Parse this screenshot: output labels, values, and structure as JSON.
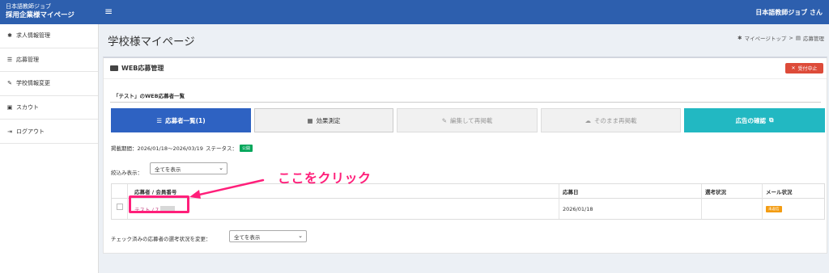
{
  "header": {
    "brand_line1": "日本語教師ジョブ",
    "brand_line2": "採用企業様マイページ",
    "menu_icon": "≡",
    "user_label": "日本語教師ジョブ さん",
    "bar_color": "#2d5fae"
  },
  "sidebar": {
    "items": [
      {
        "icon": "briefcase-icon",
        "glyph": "✱",
        "label": "求人情報管理"
      },
      {
        "icon": "list-icon",
        "glyph": "☰",
        "label": "応募管理"
      },
      {
        "icon": "edit-icon",
        "glyph": "✎",
        "label": "学校情報変更"
      },
      {
        "icon": "user-icon",
        "glyph": "▣",
        "label": "スカウト"
      },
      {
        "icon": "logout-icon",
        "glyph": "⇥",
        "label": "ログアウト"
      }
    ]
  },
  "page": {
    "title": "学校様マイページ",
    "breadcrumb": {
      "home_glyph": "✱",
      "home": "マイページトップ",
      "sep": ">",
      "current_glyph": "▤",
      "current": "応募管理"
    }
  },
  "card": {
    "title": "WEB応募管理",
    "stop_button": "受付中止",
    "stop_glyph": "✕",
    "list_title": "「テスト」のWEB応募者一覧",
    "tabs": [
      {
        "glyph": "☰",
        "label": "応募者一覧(1)",
        "state": "active"
      },
      {
        "glyph": "▦",
        "label": "効果測定",
        "state": "default"
      },
      {
        "glyph": "✎",
        "label": "編集して再掲載",
        "state": "disabled"
      },
      {
        "glyph": "☁",
        "label": "そのまま再掲載",
        "state": "disabled"
      },
      {
        "glyph": "⧉",
        "label": "広告の確認",
        "state": "info"
      }
    ],
    "period_label": "掲載期間：2026/01/18〜2026/03/19",
    "status_label": "ステータス：",
    "status_badge": "公開",
    "filter_label": "絞込み表示：",
    "filter_value": "全てを表示",
    "table": {
      "headers": [
        "応募者 / 会員番号",
        "応募日",
        "選考状況",
        "メール状況"
      ],
      "rows": [
        {
          "applicant": "テスト / 7",
          "date": "2026/01/18",
          "selection": "",
          "mail": "未返信"
        }
      ]
    },
    "bulk_label": "チェック済みの応募者の選考状況を変更：",
    "bulk_value": "全てを表示"
  },
  "annotation": {
    "text": "ここをクリック",
    "color": "#ff1f7a"
  }
}
